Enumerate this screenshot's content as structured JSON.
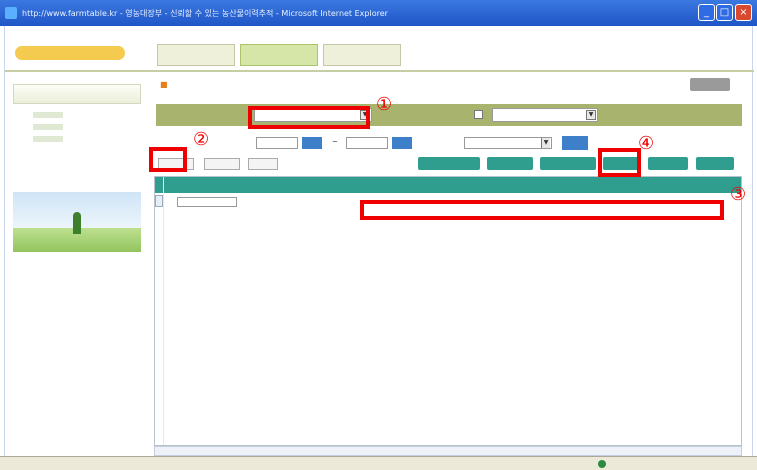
{
  "window": {
    "title": "http://www.farmtable.kr - 영농대장부 - 신뢰할 수 있는 농산물이력추적 - Microsoft Internet Explorer"
  },
  "annotations": {
    "n1": "①",
    "n2": "②",
    "n3": "③",
    "n4": "④"
  },
  "colors": {
    "annotation": "#ee0000",
    "grid_header": "#2f9e8e",
    "filter_bar": "#a8b46e"
  }
}
